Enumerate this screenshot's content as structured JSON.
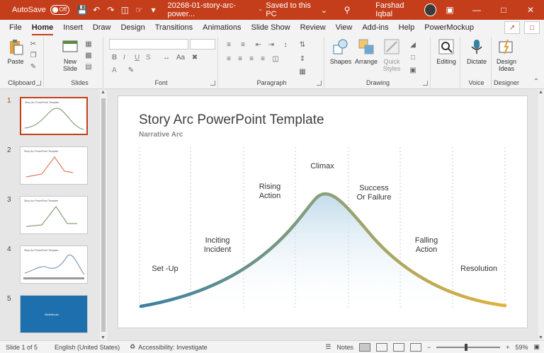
{
  "titlebar": {
    "autosave_label": "AutoSave",
    "autosave_state": "Off",
    "filename": "20268-01-story-arc-power...",
    "saved_status": "Saved to this PC",
    "user_name": "Farshad Iqbal",
    "accent_color": "#c43e1c"
  },
  "tabs": [
    "File",
    "Home",
    "Insert",
    "Draw",
    "Design",
    "Transitions",
    "Animations",
    "Slide Show",
    "Review",
    "View",
    "Add-ins",
    "Help",
    "PowerMockup"
  ],
  "active_tab": "Home",
  "ribbon": {
    "clipboard": {
      "paste": "Paste",
      "label": "Clipboard"
    },
    "slides": {
      "new_slide_1": "New",
      "new_slide_2": "Slide",
      "label": "Slides"
    },
    "font": {
      "label": "Font",
      "bold": "B",
      "italic": "I",
      "underline": "U",
      "strike": "S",
      "font_color": "A"
    },
    "paragraph": {
      "label": "Paragraph"
    },
    "drawing": {
      "shapes": "Shapes",
      "arrange": "Arrange",
      "quick_styles_1": "Quick",
      "quick_styles_2": "Styles",
      "label": "Drawing"
    },
    "editing": {
      "editing": "Editing"
    },
    "voice": {
      "dictate": "Dictate",
      "label": "Voice"
    },
    "designer": {
      "design_ideas_1": "Design",
      "design_ideas_2": "Ideas",
      "label": "Designer"
    }
  },
  "thumbnails": [
    {
      "num": "1",
      "title": "Story Arc PowerPoint Template"
    },
    {
      "num": "2",
      "title": "Story Arc PowerPoint Template"
    },
    {
      "num": "3",
      "title": "Story Arc PowerPoint Template"
    },
    {
      "num": "4",
      "title": "Story Arc PowerPoint Template"
    },
    {
      "num": "5",
      "title": "SlideModel"
    }
  ],
  "slide": {
    "title": "Story Arc PowerPoint Template",
    "subtitle": "Narrative Arc",
    "labels": {
      "setup": "Set -Up",
      "inciting_1": "Inciting",
      "inciting_2": "Incident",
      "rising_1": "Rising",
      "rising_2": "Action",
      "climax": "Climax",
      "success_1": "Success",
      "success_2": "Or Failure",
      "falling_1": "Falling",
      "falling_2": "Action",
      "resolution": "Resolution"
    },
    "curve_colors": {
      "start": "#3b7fa0",
      "middle": "#8aa07a",
      "end": "#e2b13a"
    }
  },
  "status": {
    "slide_of": "Slide 1 of 5",
    "language": "English (United States)",
    "accessibility": "Accessibility: Investigate",
    "notes": "Notes",
    "zoom": "59%"
  }
}
